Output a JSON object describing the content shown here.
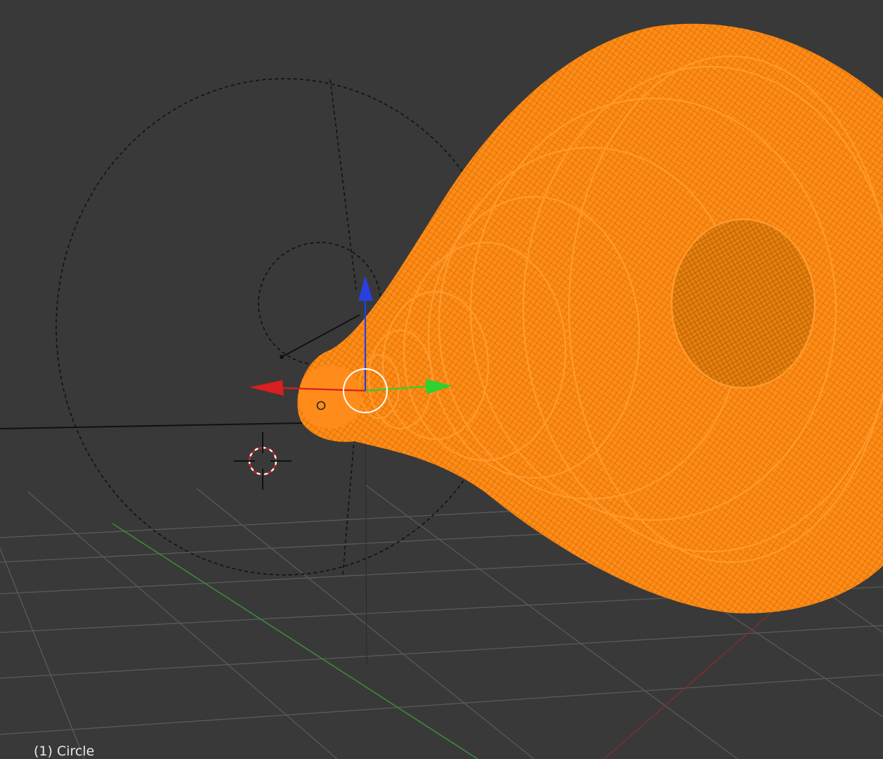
{
  "viewport": {
    "object_label": "(1) Circle",
    "background_color": "#393939",
    "selection_color": "#ff8c1a",
    "selection_wire_color": "#e07400",
    "grid_color": "#5a5a5a",
    "axis_x_color": "#7a2e2e",
    "axis_y_color": "#3c8a3c",
    "dashed_color": "#111111"
  },
  "gizmo": {
    "x_axis_color": "#d91f1f",
    "y_axis_color": "#2ed12e",
    "z_axis_color": "#2840e0"
  },
  "icons": {
    "cursor": "3d-cursor-icon",
    "manipulator": "transform-manipulator-icon",
    "camera": "camera-object-icon",
    "origin": "object-origin-icon"
  }
}
